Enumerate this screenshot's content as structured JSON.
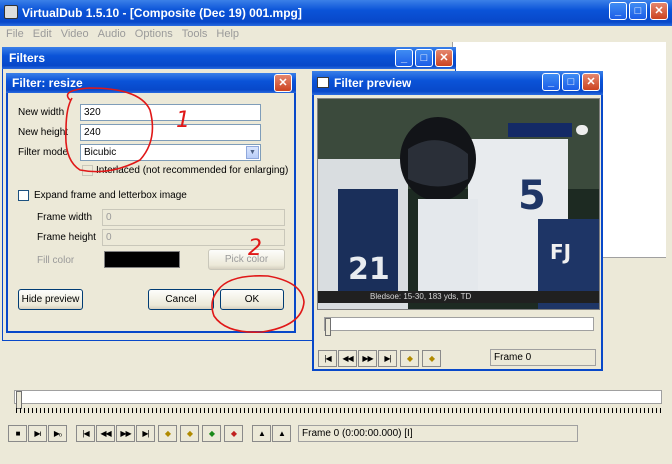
{
  "main_window": {
    "title": "VirtualDub 1.5.10 - [Composite (Dec 19) 001.mpg]",
    "menu": [
      "File",
      "Edit",
      "Video",
      "Audio",
      "Options",
      "Tools",
      "Help"
    ],
    "frame_status": "Frame 0 (0:00:00.000) [I]"
  },
  "filters_window": {
    "title": "Filters"
  },
  "resize_dialog": {
    "title": "Filter: resize",
    "new_width_label": "New width",
    "new_width_value": "320",
    "new_height_label": "New height",
    "new_height_value": "240",
    "filter_mode_label": "Filter mode",
    "filter_mode_value": "Bicubic",
    "interlaced_label": "Interlaced (not recommended for enlarging)",
    "expand_label": "Expand frame and letterbox image",
    "frame_width_label": "Frame width",
    "frame_width_value": "0",
    "frame_height_label": "Frame height",
    "frame_height_value": "0",
    "fill_color_label": "Fill color",
    "fill_color": "#000000",
    "pick_color_label": "Pick color",
    "hide_preview_label": "Hide preview",
    "cancel_label": "Cancel",
    "ok_label": "OK"
  },
  "preview_window": {
    "title": "Filter preview",
    "frame_label": "Frame 0",
    "ticker": "Bledsoe: 15-30, 183 yds, TD"
  },
  "annotations": [
    "1",
    "2"
  ],
  "colors": {
    "titlebar": "#0a53d8",
    "annotation": "#e01818",
    "dialog_bg": "#ece9d8"
  }
}
